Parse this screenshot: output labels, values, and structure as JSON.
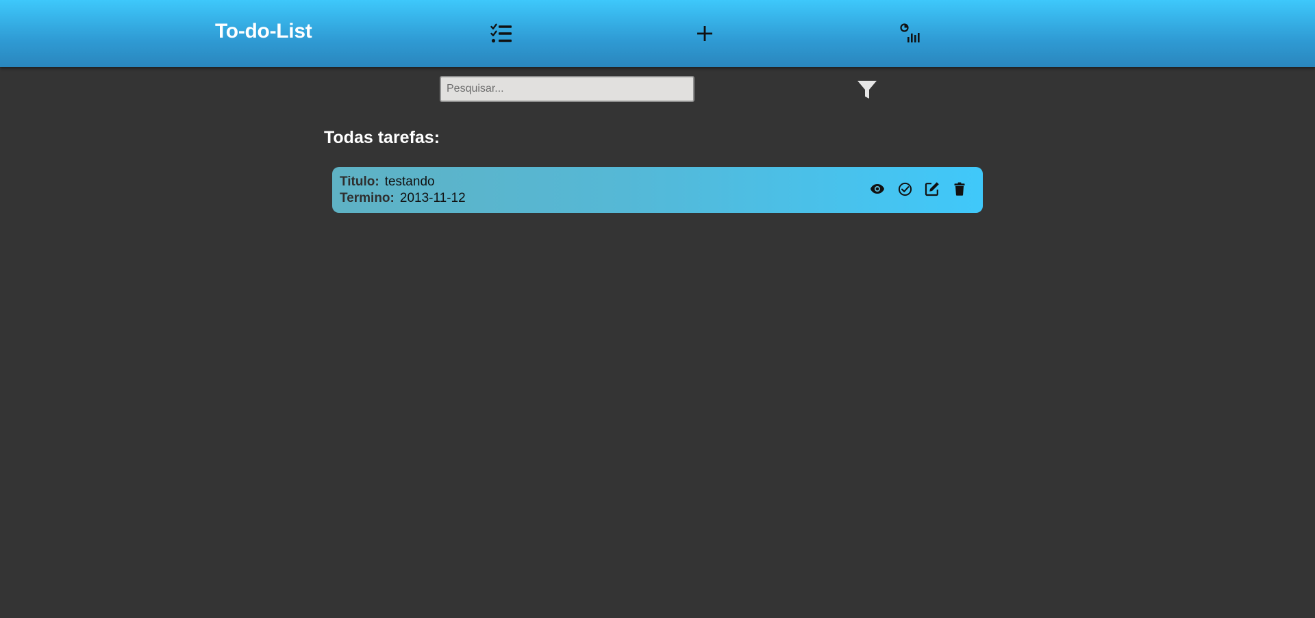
{
  "header": {
    "brand": "To-do-List",
    "nav": [
      {
        "icon": "checklist-icon"
      },
      {
        "icon": "plus-icon"
      },
      {
        "icon": "chart-icon"
      }
    ]
  },
  "search": {
    "placeholder": "Pesquisar...",
    "value": ""
  },
  "filter": {
    "icon": "filter-icon"
  },
  "section": {
    "title": "Todas tarefas:"
  },
  "tasks": [
    {
      "title_label": "Titulo:",
      "title": "testando",
      "due_label": "Termino:",
      "due": "2013-11-12",
      "actions": [
        "eye-icon",
        "check-circle-icon",
        "edit-icon",
        "trash-icon"
      ]
    }
  ],
  "colors": {
    "background": "#343434",
    "header_top": "#3ec8fb",
    "header_bottom": "#2a86bd",
    "card_left": "#5fb2c4",
    "card_right": "#40c8fa"
  }
}
